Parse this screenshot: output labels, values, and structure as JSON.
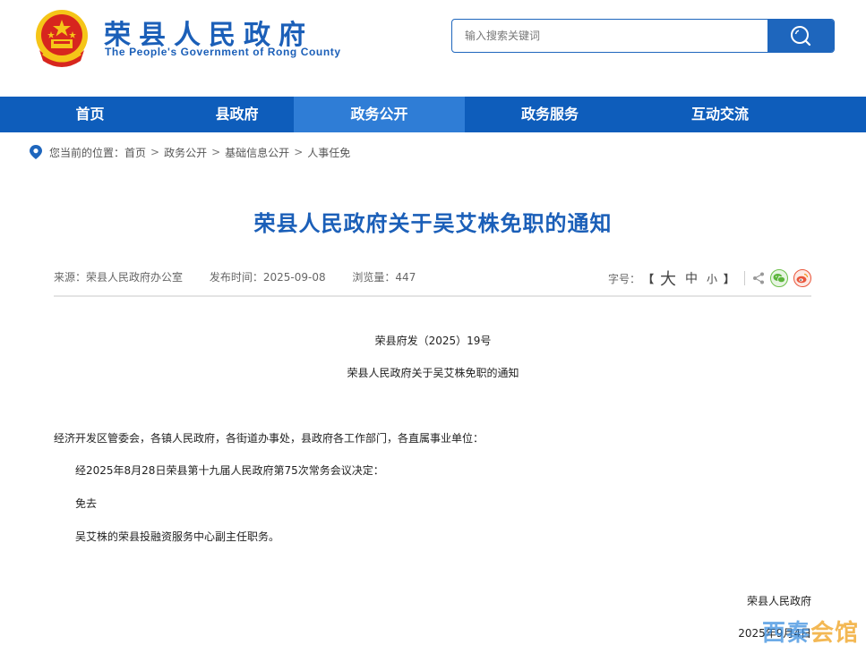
{
  "header": {
    "title_cn": "荣县人民政府",
    "title_en": "The People's Government of Rong County",
    "search_placeholder": "输入搜索关键词"
  },
  "nav": {
    "items": [
      {
        "label": "首页"
      },
      {
        "label": "县政府"
      },
      {
        "label": "政务公开"
      },
      {
        "label": "政务服务"
      },
      {
        "label": "互动交流"
      }
    ],
    "active_index": 2
  },
  "breadcrumb": {
    "prefix": "您当前的位置：",
    "items": [
      "首页",
      "政务公开",
      "基础信息公开",
      "人事任免"
    ],
    "separator": ">"
  },
  "article": {
    "title": "荣县人民政府关于吴艾株免职的通知",
    "meta": {
      "source": "来源：荣县人民政府办公室",
      "published": "发布时间：2025-09-08",
      "views": "浏览量：447",
      "font_label": "字号：",
      "bracket_open": "【",
      "bracket_close": "】",
      "font_big": "大",
      "font_mid": "中",
      "font_small": "小"
    },
    "doc_number": "荣县府发（2025）19号",
    "doc_title": "荣县人民政府关于吴艾株免职的通知",
    "addressee": "经济开发区管委会，各镇人民政府，各街道办事处，县政府各工作部门，各直属事业单位：",
    "para1": "经2025年8月28日荣县第十九届人民政府第75次常务会议决定：",
    "para2": "免去",
    "para3": "吴艾株的荣县投融资服务中心副主任职务。",
    "signature": "荣县人民政府",
    "date": "2025年9月4日"
  },
  "watermark": {
    "part1": "西秦",
    "part2": "会馆"
  },
  "colors": {
    "brand_blue": "#1b5fb8",
    "nav_blue": "#0e5dbb",
    "nav_active": "#2f7dd6",
    "emblem_red": "#d7261e",
    "emblem_gold": "#f5c518"
  },
  "icons": [
    "national-emblem-icon",
    "search-icon",
    "location-pin-icon",
    "share-icon",
    "wechat-icon",
    "weibo-icon"
  ]
}
